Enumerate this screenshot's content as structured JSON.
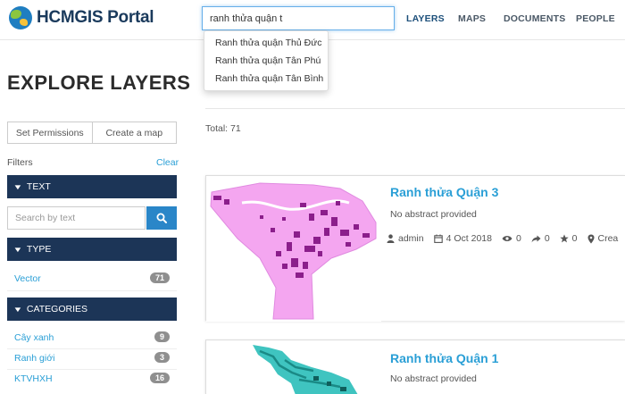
{
  "header": {
    "brand": "HCMGIS Portal",
    "search_value": "ranh thửa quận t",
    "nav": [
      "LAYERS",
      "MAPS",
      "DOCUMENTS",
      "PEOPLE"
    ]
  },
  "suggestions": [
    "Ranh thửa quận Thủ Đức",
    "Ranh thửa quận Tân Phú",
    "Ranh thửa quận Tân Bình"
  ],
  "page_title": "EXPLORE LAYERS",
  "sidebar": {
    "set_permissions": "Set Permissions",
    "create_map": "Create a map",
    "filters_label": "Filters",
    "clear_label": "Clear",
    "text_facet": "TEXT",
    "search_placeholder": "Search by text",
    "type_facet": "TYPE",
    "type_items": [
      {
        "label": "Vector",
        "count": "71"
      }
    ],
    "categories_facet": "CATEGORIES",
    "category_items": [
      {
        "label": "Cây xanh",
        "count": "9"
      },
      {
        "label": "Ranh giới",
        "count": "3"
      },
      {
        "label": "KTVHXH",
        "count": "16"
      }
    ]
  },
  "results": {
    "total": "Total: 71",
    "layers": [
      {
        "title": "Ranh thửa Quận 3",
        "abstract": "No abstract provided",
        "owner": "admin",
        "date": "4 Oct 2018",
        "views": "0",
        "shares": "0",
        "rating": "0",
        "category": "Crea"
      },
      {
        "title": "Ranh thửa Quận 1",
        "abstract": "No abstract provided"
      }
    ]
  },
  "colors": {
    "brand_navy": "#1c3557",
    "link_blue": "#2a9fd6",
    "search_button": "#2a86c8",
    "badge_gray": "#8f8f8f",
    "map_fill_q3": "#f4a6f0",
    "map_parcels_q3": "#8b1e8b",
    "map_fill_q1": "#3fc4c0"
  }
}
